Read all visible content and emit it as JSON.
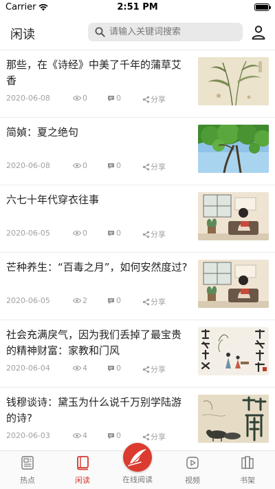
{
  "status_bar": {
    "carrier": "Carrier",
    "time": "2:51 PM"
  },
  "header": {
    "app_title": "闲读",
    "search_placeholder": "请输入关键词搜索"
  },
  "articles": [
    {
      "title": "那些，在《诗经》中美了千年的蒲草艾香",
      "date": "2020-06-08",
      "views": "0",
      "comments": "0",
      "share_label": "分享",
      "thumb": "ink-plant-painting"
    },
    {
      "title": "简媜：夏之绝句",
      "date": "2020-06-08",
      "views": "0",
      "comments": "0",
      "share_label": "分享",
      "thumb": "green-tree-sky-photo"
    },
    {
      "title": "六七十年代穿衣往事",
      "date": "2020-06-05",
      "views": "0",
      "comments": "0",
      "share_label": "分享",
      "thumb": "girl-reading-illustration"
    },
    {
      "title": "芒种养生：“百毒之月”，如何安然度过?",
      "date": "2020-06-05",
      "views": "2",
      "comments": "0",
      "share_label": "分享",
      "thumb": "girl-reading-illustration"
    },
    {
      "title": "社会充满戾气，因为我们丢掉了最宝贵的精神财富：家教和门风",
      "date": "2020-06-04",
      "views": "4",
      "comments": "0",
      "share_label": "分享",
      "thumb": "calligraphy-figures-painting"
    },
    {
      "title": "钱穆谈诗：黛玉为什么说千万别学陆游的诗?",
      "date": "2020-06-03",
      "views": "4",
      "comments": "0",
      "share_label": "分享",
      "thumb": "ink-cattle-calligraphy"
    }
  ],
  "tab_bar": {
    "tabs": [
      {
        "label": "热点",
        "icon": "newspaper-icon",
        "active": false
      },
      {
        "label": "闲读",
        "icon": "book-icon",
        "active": true
      },
      {
        "label": "在线阅读",
        "icon": "feather-logo-icon",
        "active": false
      },
      {
        "label": "视频",
        "icon": "play-icon",
        "active": false
      },
      {
        "label": "书架",
        "icon": "bookshelf-icon",
        "active": false
      }
    ]
  },
  "colors": {
    "accent": "#d23a2f",
    "meta_text": "#a0a0a0",
    "search_bg": "#e9e9ea"
  }
}
